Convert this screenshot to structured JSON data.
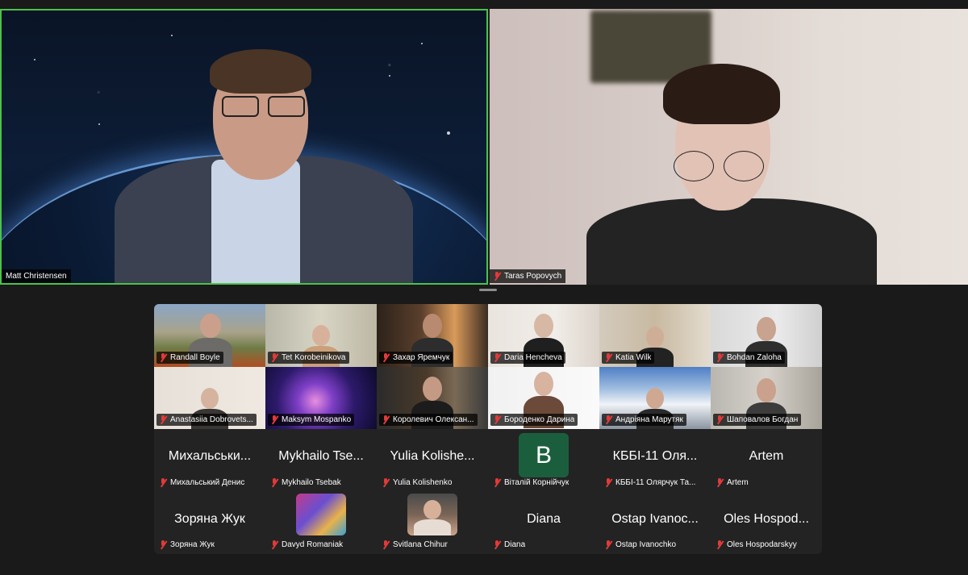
{
  "speakers": [
    {
      "name": "Matt Christensen",
      "active": true,
      "muted": false
    },
    {
      "name": "Taras Popovych",
      "active": false,
      "muted": true
    }
  ],
  "gallery": [
    {
      "name": "Randall Boyle",
      "video": true,
      "muted": true
    },
    {
      "name": "Tet Korobeinikova",
      "video": true,
      "muted": true
    },
    {
      "name": "Захар Яремчук",
      "video": true,
      "muted": true
    },
    {
      "name": "Daria Hencheva",
      "video": true,
      "muted": true
    },
    {
      "name": "Katia Wilk",
      "video": true,
      "muted": true
    },
    {
      "name": "Bohdan Zaloha",
      "video": true,
      "muted": true
    },
    {
      "name": "Anastasiia Dobrovets...",
      "video": true,
      "muted": true
    },
    {
      "name": "Maksym Mospanko",
      "video": true,
      "muted": true
    },
    {
      "name": "Королевич Олексан...",
      "video": true,
      "muted": true
    },
    {
      "name": "Бороденко Дарина",
      "video": true,
      "muted": true
    },
    {
      "name": "Андріяна Марутяк",
      "video": true,
      "muted": true
    },
    {
      "name": "Шаповалов Богдан",
      "video": true,
      "muted": true
    },
    {
      "name": "Михальський Денис",
      "display": "Михальськи...",
      "video": false,
      "muted": true
    },
    {
      "name": "Mykhailo Tsebak",
      "display": "Mykhailo Tse...",
      "video": false,
      "muted": true
    },
    {
      "name": "Yulia Kolishenko",
      "display": "Yulia Kolishe...",
      "video": false,
      "muted": true
    },
    {
      "name": "Віталій Корнійчук",
      "avatar_letter": "B",
      "video": false,
      "muted": true
    },
    {
      "name": "КББІ-11 Олярчук Та...",
      "display": "КББІ-11 Оля...",
      "video": false,
      "muted": true
    },
    {
      "name": "Artem",
      "display": "Artem",
      "video": false,
      "muted": true
    },
    {
      "name": "Зоряна Жук",
      "display": "Зоряна Жук",
      "video": false,
      "muted": true
    },
    {
      "name": "Davyd Romaniak",
      "avatar_image": "illustrated-character",
      "video": false,
      "muted": true
    },
    {
      "name": "Svitlana Chihur",
      "avatar_image": "photo",
      "video": false,
      "muted": true
    },
    {
      "name": "Diana",
      "display": "Diana",
      "video": false,
      "muted": true
    },
    {
      "name": "Ostap Ivanochko",
      "display": "Ostap Ivanoc...",
      "video": false,
      "muted": true
    },
    {
      "name": "Oles Hospodarskyy",
      "display": "Oles Hospod...",
      "video": false,
      "muted": true
    }
  ],
  "colors": {
    "active_speaker_border": "#4cc24a",
    "muted_icon": "#e03a3a",
    "background": "#1a1a1a",
    "avatar_b": "#1b5e3e"
  }
}
